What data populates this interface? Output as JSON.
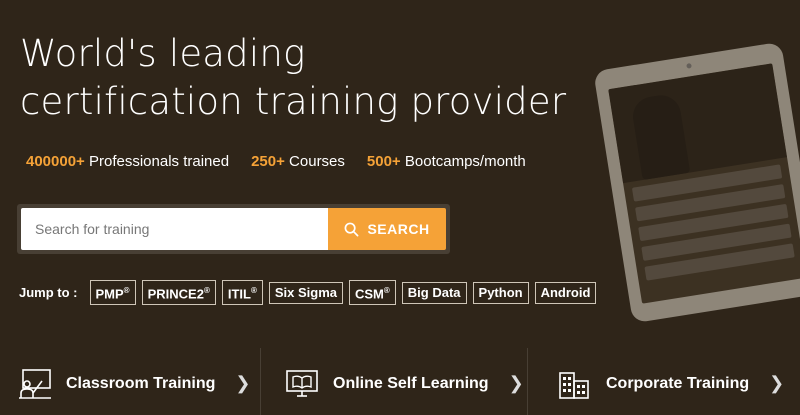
{
  "hero": {
    "title_line1": "World's leading",
    "title_line2": "certification training provider"
  },
  "stats": [
    {
      "number": "400000+",
      "label": "Professionals trained"
    },
    {
      "number": "250+",
      "label": "Courses"
    },
    {
      "number": "500+",
      "label": "Bootcamps/month"
    }
  ],
  "search": {
    "placeholder": "Search for training",
    "button_label": "SEARCH",
    "icon": "search-icon"
  },
  "jump_to": {
    "label": "Jump to :",
    "tags": [
      {
        "name": "PMP",
        "mark": "®"
      },
      {
        "name": "PRINCE2",
        "mark": "®"
      },
      {
        "name": "ITIL",
        "mark": "®"
      },
      {
        "name": "Six Sigma",
        "mark": ""
      },
      {
        "name": "CSM",
        "mark": "®"
      },
      {
        "name": "Big Data",
        "mark": ""
      },
      {
        "name": "Python",
        "mark": ""
      },
      {
        "name": "Android",
        "mark": ""
      }
    ]
  },
  "bottom_nav": [
    {
      "label": "Classroom Training",
      "icon": "classroom-icon"
    },
    {
      "label": "Online Self Learning",
      "icon": "monitor-icon"
    },
    {
      "label": "Corporate Training",
      "icon": "building-icon"
    }
  ],
  "colors": {
    "background": "#2f2519",
    "accent": "#f5a237",
    "text": "#ffffff"
  }
}
